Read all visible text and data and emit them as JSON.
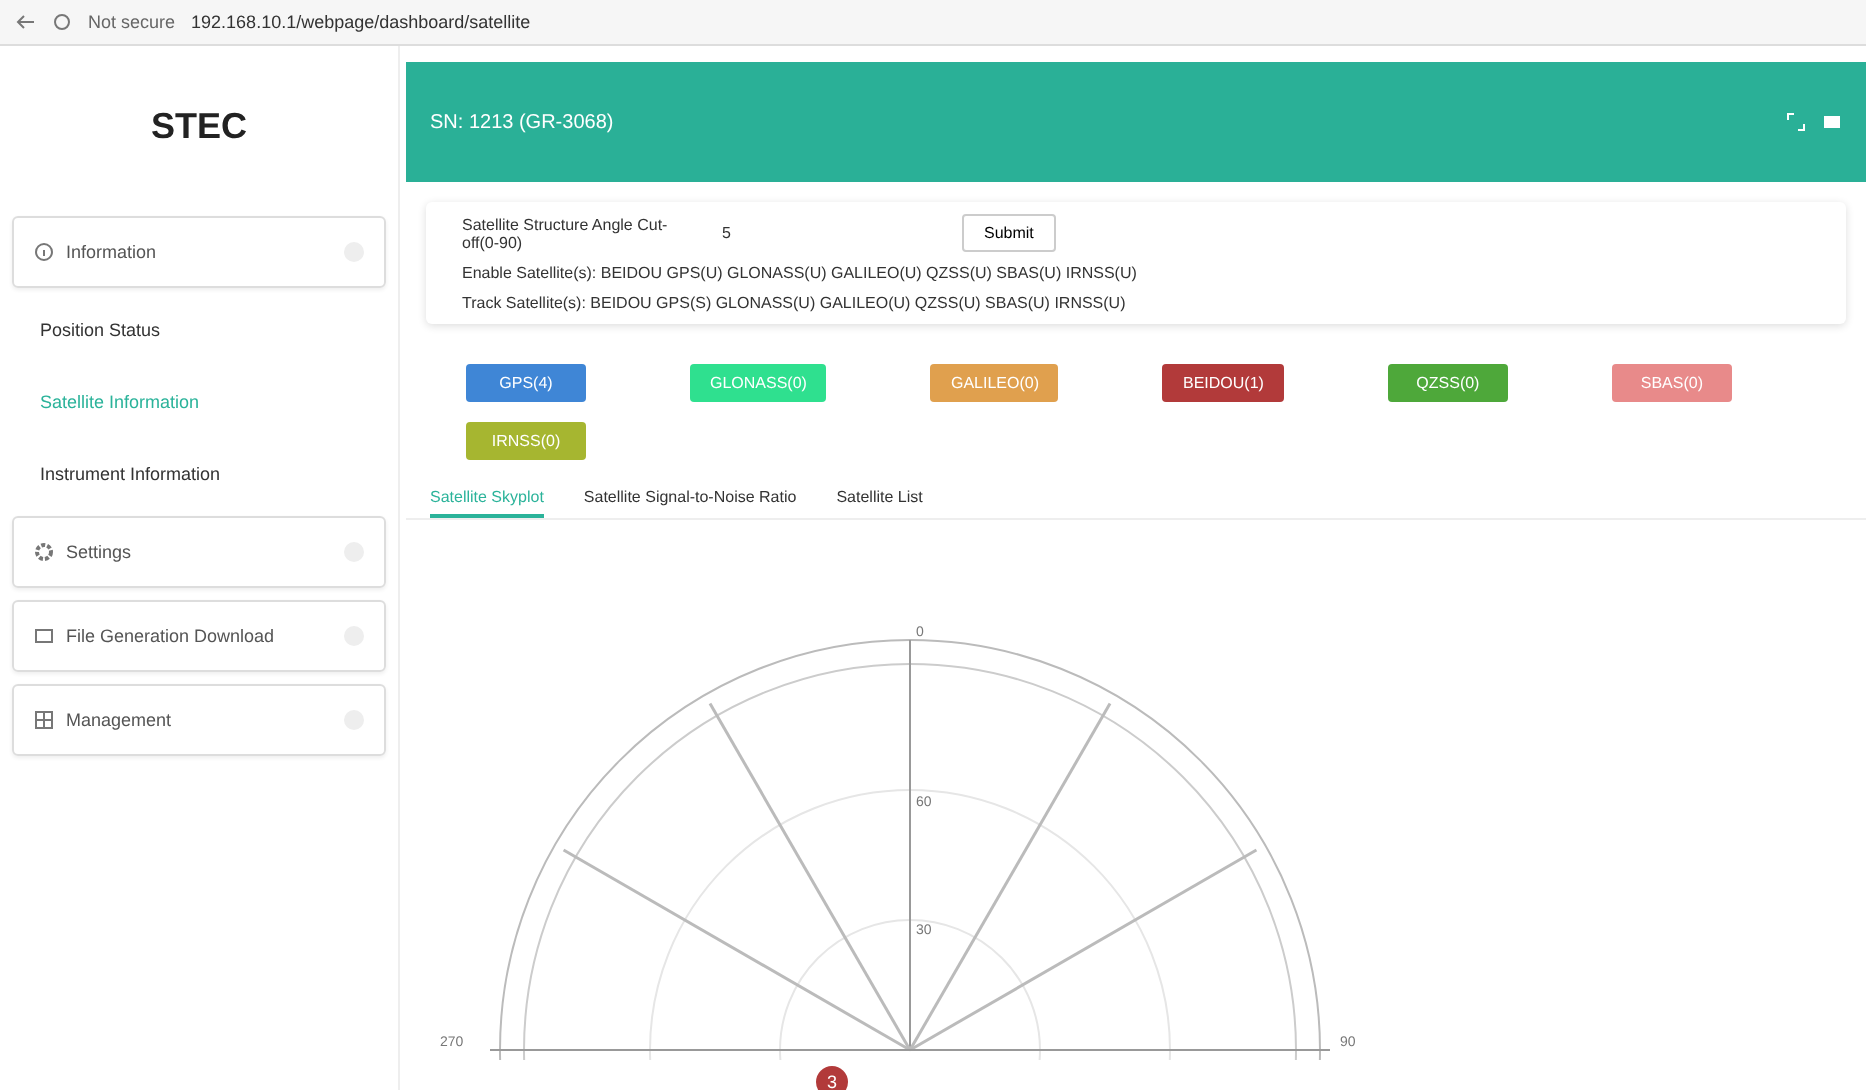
{
  "browser": {
    "security": "Not secure",
    "url": "192.168.10.1/webpage/dashboard/satellite"
  },
  "logo": "STEC",
  "header": {
    "title": "SN: 1213 (GR-3068)"
  },
  "sidebar": [
    {
      "label": "Information",
      "kind": "group",
      "children": [
        {
          "label": "Position Status",
          "selected": false
        },
        {
          "label": "Satellite Information",
          "selected": true
        },
        {
          "label": "Instrument Information",
          "selected": false
        }
      ]
    },
    {
      "label": "Settings",
      "kind": "group"
    },
    {
      "label": "File Generation Download",
      "kind": "group"
    },
    {
      "label": "Management",
      "kind": "group"
    }
  ],
  "cutoff": {
    "label": "Satellite Structure Angle Cut-off(0-90)",
    "value": "5",
    "button": "Submit"
  },
  "enabled": "Enable Satellite(s): BEIDOU GPS(U) GLONASS(U) GALILEO(U) QZSS(U) SBAS(U) IRNSS(U)",
  "tracked": "Track Satellite(s): BEIDOU GPS(S) GLONASS(U) GALILEO(U) QZSS(U) SBAS(U) IRNSS(U)",
  "systems": [
    {
      "label": "GPS(4)",
      "color": "#3f86d6"
    },
    {
      "label": "GLONASS(0)",
      "color": "#2fe08f"
    },
    {
      "label": "GALILEO(0)",
      "color": "#e0a04e"
    },
    {
      "label": "BEIDOU(1)",
      "color": "#b23a3a"
    },
    {
      "label": "QZSS(0)",
      "color": "#4ea83a"
    },
    {
      "label": "SBAS(0)",
      "color": "#e88a8a"
    },
    {
      "label": "IRNSS(0)",
      "color": "#a6b630"
    }
  ],
  "tabs": [
    {
      "label": "Satellite Skyplot",
      "selected": true
    },
    {
      "label": "Satellite Signal-to-Noise Ratio",
      "selected": false
    },
    {
      "label": "Satellite List",
      "selected": false
    }
  ],
  "skyplot": {
    "north": "0",
    "rings": [
      "60",
      "30"
    ],
    "west": "270",
    "east": "90",
    "satellites": [
      {
        "label": "3",
        "color": "#b23a3a"
      }
    ]
  }
}
